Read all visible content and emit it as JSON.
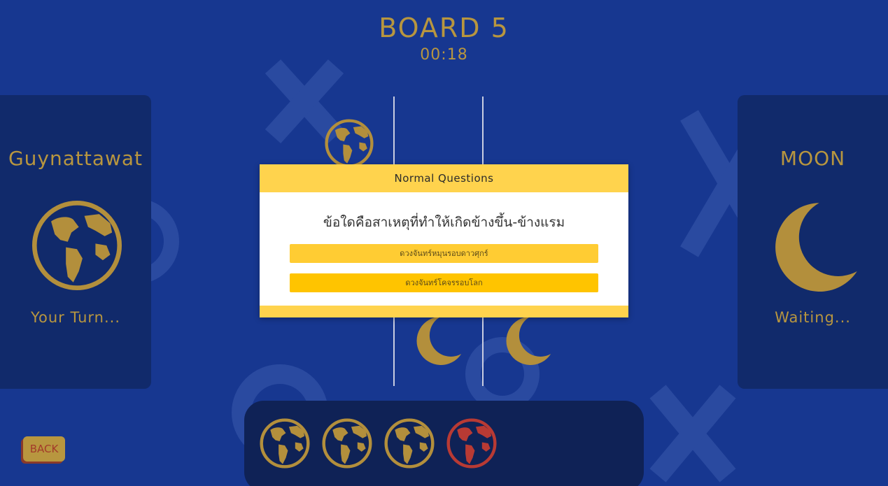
{
  "header": {
    "board_title": "BOARD 5",
    "timer": "00:18"
  },
  "players": {
    "left": {
      "name": "Guynattawat",
      "icon": "globe-icon",
      "status": "Your Turn..."
    },
    "right": {
      "name": "MOON",
      "icon": "moon-icon",
      "status": "Waiting..."
    }
  },
  "board": {
    "pieces": [
      "globe-icon",
      "moon-icon",
      "moon-icon"
    ]
  },
  "tray": {
    "pieces": [
      {
        "icon": "globe-icon",
        "color": "#b38f3c"
      },
      {
        "icon": "globe-icon",
        "color": "#b38f3c"
      },
      {
        "icon": "globe-icon",
        "color": "#b38f3c"
      },
      {
        "icon": "globe-icon",
        "color": "#b83a34"
      }
    ]
  },
  "back_button": {
    "label": "BACK"
  },
  "modal": {
    "title": "Normal Questions",
    "question": "ข้อใดคือสาเหตุที่ทำให้เกิดข้างขึ้น-ข้างแรม",
    "answers": [
      "ดวงจันทร์หมุนรอบดาวศุกร์",
      "ดวงจันทร์โคจรรอบโลก"
    ]
  },
  "colors": {
    "background": "#173790",
    "card": "#112a6b",
    "gold": "#b8963f",
    "modal_accent": "#ffd34d",
    "answer": "#ffc61a",
    "tray_highlight": "#b83a34"
  }
}
